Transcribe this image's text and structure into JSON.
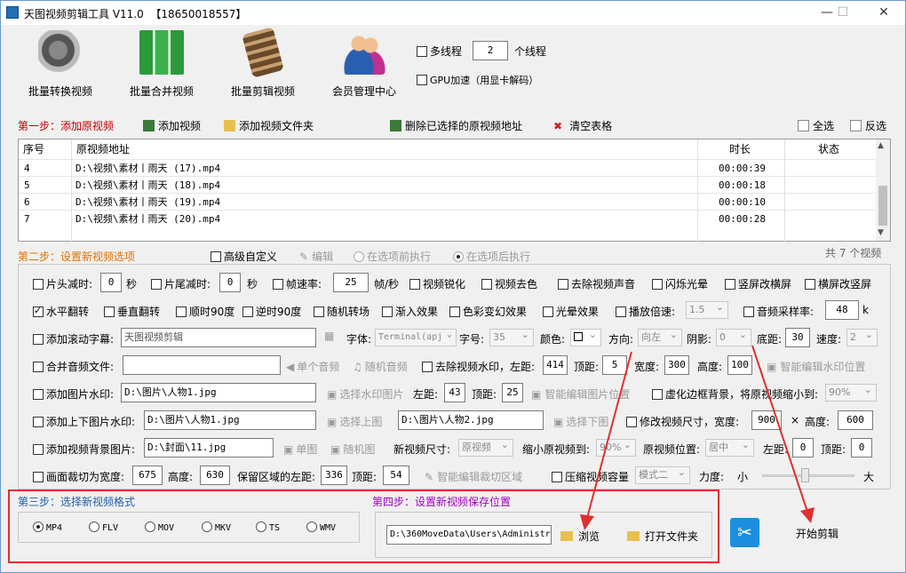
{
  "window": {
    "title": "天图视频剪辑工具 V11.0  【18650018557】",
    "min": "—",
    "max": "☐",
    "close": "✕"
  },
  "toolbar": {
    "items": [
      "批量转换视频",
      "批量合并视频",
      "批量剪辑视频",
      "会员管理中心"
    ],
    "multithread_label": "多线程",
    "thread_count": "2",
    "thread_unit": "个线程",
    "gpu_label": "GPU加速（用显卡解码）"
  },
  "step1": {
    "title": "第一步：添加原视频",
    "add_video": "添加视频",
    "add_folder": "添加视频文件夹",
    "delete_selected": "删除已选择的原视频地址",
    "clear_table": "清空表格",
    "select_all": "全选",
    "invert": "反选"
  },
  "table": {
    "headers": [
      "序号",
      "原视频地址",
      "时长",
      "状态"
    ],
    "rows": [
      {
        "no": "4",
        "path": "D:\\视频\\素材丨雨天 (17).mp4",
        "duration": "00:00:39",
        "status": ""
      },
      {
        "no": "5",
        "path": "D:\\视频\\素材丨雨天 (18).mp4",
        "duration": "00:00:18",
        "status": ""
      },
      {
        "no": "6",
        "path": "D:\\视频\\素材丨雨天 (19).mp4",
        "duration": "00:00:10",
        "status": ""
      },
      {
        "no": "7",
        "path": "D:\\视频\\素材丨雨天 (20).mp4",
        "duration": "00:00:28",
        "status": ""
      }
    ],
    "total": "共 7 个视频"
  },
  "step2": {
    "title": "第二步：设置新视频选项",
    "advanced": "高级自定义",
    "edit": "编辑",
    "before": "在选项前执行",
    "after": "在选项后执行",
    "r1": {
      "head_cut": "片头减时:",
      "head_val": "0",
      "sec1": "秒",
      "tail_cut": "片尾减时:",
      "tail_val": "0",
      "sec2": "秒",
      "fps": "帧速率:",
      "fps_val": "25",
      "fps_unit": "帧/秒",
      "sharpen": "视频锐化",
      "decolor": "视频去色",
      "mute": "去除视频声音",
      "flash": "闪烁光晕",
      "v2h": "竖屏改横屏",
      "h2v": "横屏改竖屏"
    },
    "r2": {
      "hflip": "水平翻转",
      "vflip": "垂直翻转",
      "cw90": "顺时90度",
      "ccw90": "逆时90度",
      "random": "随机转场",
      "fadein": "渐入效果",
      "color": "色彩变幻效果",
      "halo": "光晕效果",
      "speed": "播放倍速:",
      "speed_val": "1.5",
      "samplerate": "音频采样率:",
      "samplerate_val": "48",
      "k": "k"
    },
    "r3": {
      "scroll_sub": "添加滚动字幕:",
      "sub_text": "天图视频剪辑",
      "font": "字体:",
      "font_val": "Terminal(apj",
      "size": "字号:",
      "size_val": "35",
      "color": "颜色:",
      "dir": "方向:",
      "dir_val": "向左",
      "shadow": "阴影:",
      "shadow_val": "0",
      "bottom": "底距:",
      "bottom_val": "30",
      "speed": "速度:",
      "speed_val": "2"
    },
    "r4": {
      "merge_audio": "合并音频文件:",
      "single_audio": "单个音频",
      "random_audio": "随机音频",
      "rm_watermark": "去除视频水印，左距:",
      "left_val": "414",
      "top": "顶距:",
      "top_val": "5",
      "width": "宽度:",
      "width_val": "300",
      "height": "高度:",
      "height_val": "100",
      "smart_wm": "智能编辑水印位置"
    },
    "r5": {
      "img_wm": "添加图片水印:",
      "img_path": "D:\\图片\\人物1.jpg",
      "choose_wm": "选择水印图片",
      "left": "左距:",
      "left_val": "43",
      "top": "顶距:",
      "top_val": "25",
      "smart_img": "智能编辑图片位置",
      "blur_bg": "虚化边框背景，将原视频缩小到:",
      "blur_val": "90%"
    },
    "r6": {
      "updown": "添加上下图片水印:",
      "up_path": "D:\\图片\\人物1.jpg",
      "choose_up": "选择上图",
      "down_path": "D:\\图片\\人物2.jpg",
      "choose_down": "选择下图",
      "resize": "修改视频尺寸，宽度:",
      "w_val": "900",
      "x": "×",
      "h": "高度:",
      "h_val": "600"
    },
    "r7": {
      "bg_img": "添加视频背景图片:",
      "bg_path": "D:\\封面\\11.jpg",
      "single": "单图",
      "random": "随机图",
      "new_size": "新视频尺寸:",
      "new_size_val": "原视频",
      "shrink": "缩小原视频到:",
      "shrink_val": "90%",
      "pos": "原视频位置:",
      "pos_val": "居中",
      "left": "左距:",
      "left_val": "0",
      "top": "顶距:",
      "top_val": "0"
    },
    "r8": {
      "crop": "画面裁切为宽度:",
      "crop_w": "675",
      "height": "高度:",
      "crop_h": "630",
      "keep_left": "保留区域的左距:",
      "keep_left_val": "336",
      "top": "顶距:",
      "top_val": "54",
      "smart_crop": "智能编辑裁切区域",
      "compress": "压缩视频容量",
      "mode": "模式二",
      "strength": "力度:",
      "small": "小",
      "big": "大"
    }
  },
  "step3": {
    "title": "第三步：选择新视频格式",
    "formats": [
      "MP4",
      "FLV",
      "MOV",
      "MKV",
      "TS",
      "WMV"
    ],
    "selected": "MP4"
  },
  "step4": {
    "title": "第四步：设置新视频保存位置",
    "path": "D:\\360MoveData\\Users\\Administr",
    "browse": "浏览",
    "open_folder": "打开文件夹"
  },
  "start": "开始剪辑",
  "colors": {
    "accent_red": "#e03030",
    "step_orange": "#e07000",
    "step_blue": "#1f5ea8",
    "step_purple": "#a000c0"
  }
}
